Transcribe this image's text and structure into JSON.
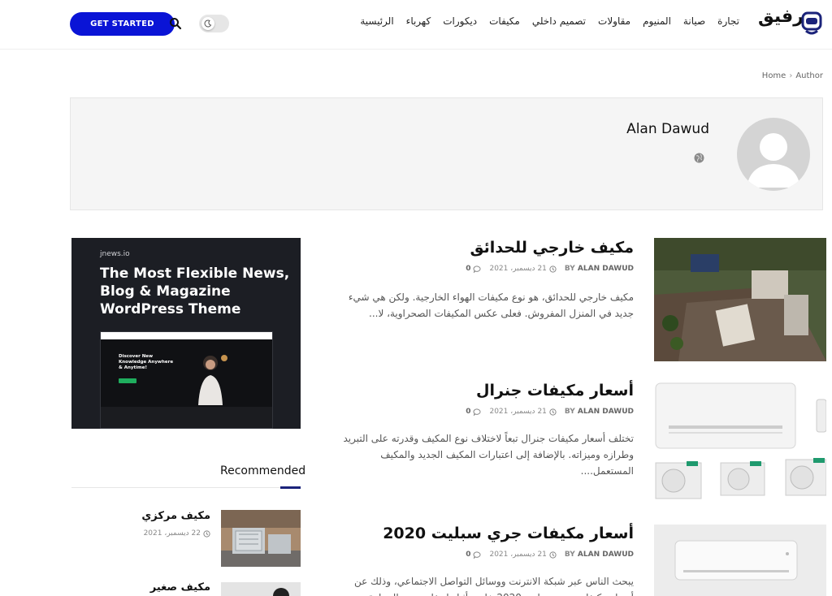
{
  "header": {
    "cta_label": "GET STARTED",
    "logo_text": "رفيق",
    "nav": [
      "الرئيسية",
      "كهرباء",
      "ديكورات",
      "مكيفات",
      "تصميم داخلي",
      "مقاولات",
      "المنيوم",
      "صيانة",
      "تجارة"
    ]
  },
  "breadcrumb": {
    "home": "Home",
    "separator": "›",
    "current": "Author"
  },
  "author": {
    "name": "Alan Dawud"
  },
  "ad": {
    "site": "jnews.io",
    "title": "The Most Flexible News, Blog & Magazine WordPress Theme",
    "shot_heading": "Discover New Knowledge Anywhere & Anytime!"
  },
  "recommended": {
    "heading": "Recommended",
    "items": [
      {
        "title": "مكيف مركزي",
        "date": "22 ديسمبر، 2021"
      },
      {
        "title": "مكيف صغير",
        "date": ""
      }
    ]
  },
  "posts": [
    {
      "title": "مكيف خارجي للحدائق",
      "by": "BY",
      "author": "ALAN DAWUD",
      "date": "21 ديسمبر، 2021",
      "comments": "0",
      "excerpt": "مكيف خارجي للحدائق، هو نوع مكيفات الهواء الخارجية. ولكن هي شيء جديد في المنزل المفروش. فعلى عكس المكيفات الصحراوية، لا..."
    },
    {
      "title": "أسعار مكيفات جنرال",
      "by": "BY",
      "author": "ALAN DAWUD",
      "date": "21 ديسمبر، 2021",
      "comments": "0",
      "excerpt": "تختلف أسعار مكيفات جنرال تبعاً لاختلاف نوع المكيف وقدرته على التبريد وطرازه وميزاته. بالإضافة إلى اعتبارات المكيف الجديد والمكيف المستعمل...."
    },
    {
      "title": "أسعار مكيفات جري سبليت 2020",
      "by": "BY",
      "author": "ALAN DAWUD",
      "date": "21 ديسمبر، 2021",
      "comments": "0",
      "excerpt": "يبحث الناس عبر شبكة الانترنت ووسائل التواصل الاجتماعي، وذلك عن أسعار مكيفات جري سبليت 2020 خاصة أثناء ارتفاع درجة الحرارة"
    }
  ],
  "colors": {
    "accent": "#0a14d6",
    "dark_accent": "#1b237a"
  }
}
